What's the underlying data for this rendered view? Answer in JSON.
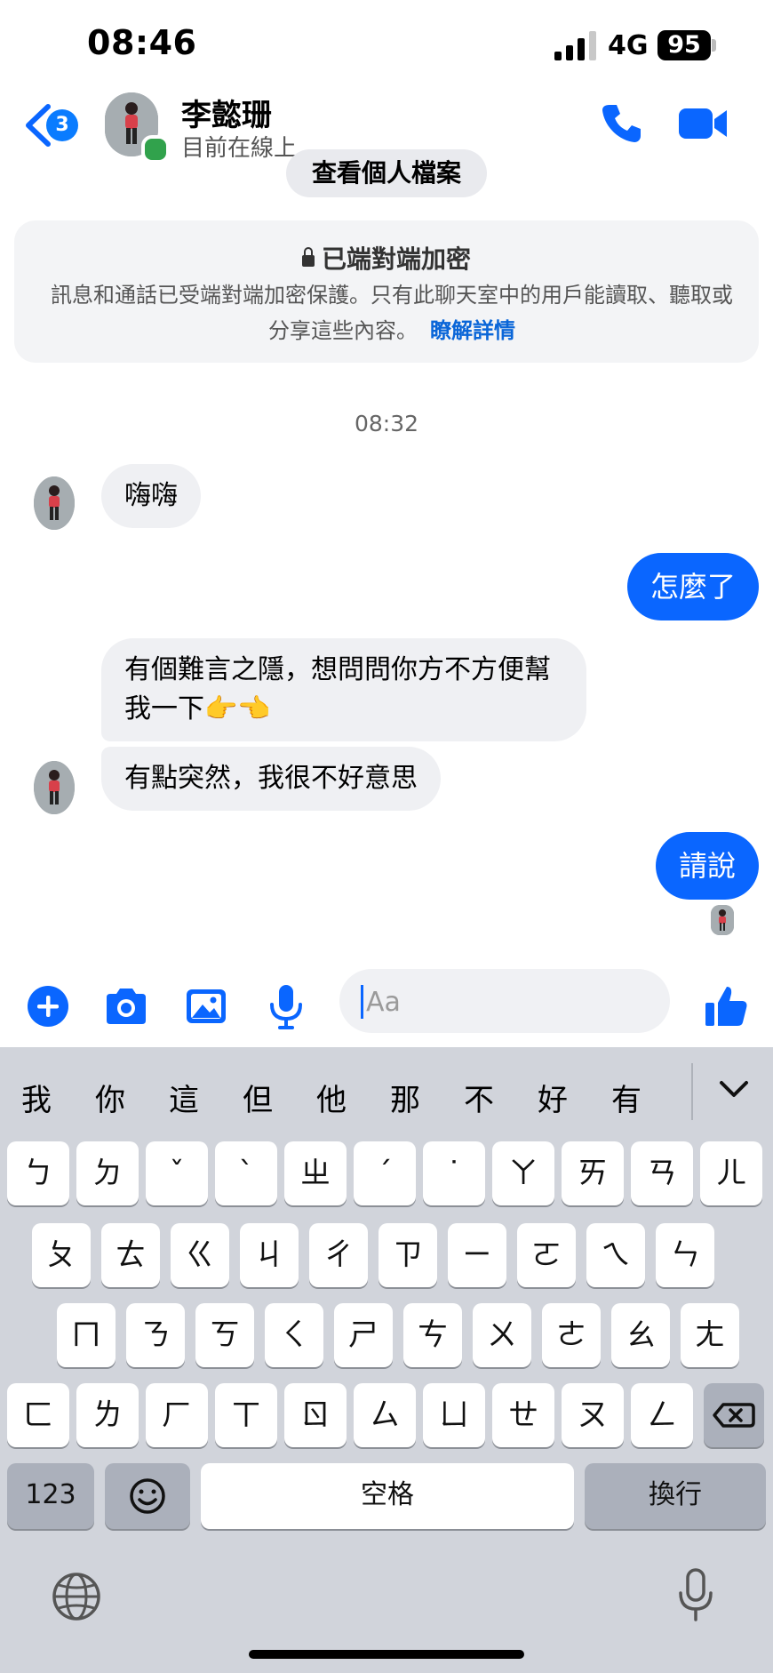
{
  "status_bar": {
    "time": "08:46",
    "network": "4G",
    "battery": "95"
  },
  "header": {
    "back_count": "3",
    "contact_name": "李懿珊",
    "contact_status": "目前在線上"
  },
  "profile_button": "查看個人檔案",
  "encryption": {
    "title": "已端對端加密",
    "body": "訊息和通話已受端對端加密保護。只有此聊天室中的用戶能讀取、聽取或分享這些內容。",
    "link": "瞭解詳情"
  },
  "timestamp": "08:32",
  "messages": [
    {
      "from": "them",
      "text": "嗨嗨"
    },
    {
      "from": "me",
      "text": "怎麼了"
    },
    {
      "from": "them",
      "text": "有個難言之隱，想問問你方不方便幫我一下👉👈"
    },
    {
      "from": "them",
      "text": "有點突然，我很不好意思"
    },
    {
      "from": "me",
      "text": "請說"
    }
  ],
  "composer": {
    "placeholder": "Aa",
    "icons": [
      "plus-icon",
      "camera-icon",
      "image-icon",
      "microphone-icon",
      "emoji-icon",
      "thumbs-up-icon"
    ]
  },
  "keyboard": {
    "candidates": [
      "我",
      "你",
      "這",
      "但",
      "他",
      "那",
      "不",
      "好",
      "有"
    ],
    "row1": [
      "ㄅ",
      "ㄉ",
      "ˇ",
      "ˋ",
      "ㄓ",
      "ˊ",
      "˙",
      "ㄚ",
      "ㄞ",
      "ㄢ",
      "ㄦ"
    ],
    "row2": [
      "ㄆ",
      "ㄊ",
      "ㄍ",
      "ㄐ",
      "ㄔ",
      "ㄗ",
      "ㄧ",
      "ㄛ",
      "ㄟ",
      "ㄣ"
    ],
    "row3": [
      "ㄇ",
      "ㄋ",
      "ㄎ",
      "ㄑ",
      "ㄕ",
      "ㄘ",
      "ㄨ",
      "ㄜ",
      "ㄠ",
      "ㄤ"
    ],
    "row4": [
      "ㄈ",
      "ㄌ",
      "ㄏ",
      "ㄒ",
      "ㄖ",
      "ㄙ",
      "ㄩ",
      "ㄝ",
      "ㄡ",
      "ㄥ"
    ],
    "numbers_label": "123",
    "space_label": "空格",
    "return_label": "換行"
  },
  "colors": {
    "accent": "#0a66ff",
    "online": "#31a24c",
    "bubble_in": "#eff0f3",
    "keyboard_bg": "#d1d4db"
  }
}
